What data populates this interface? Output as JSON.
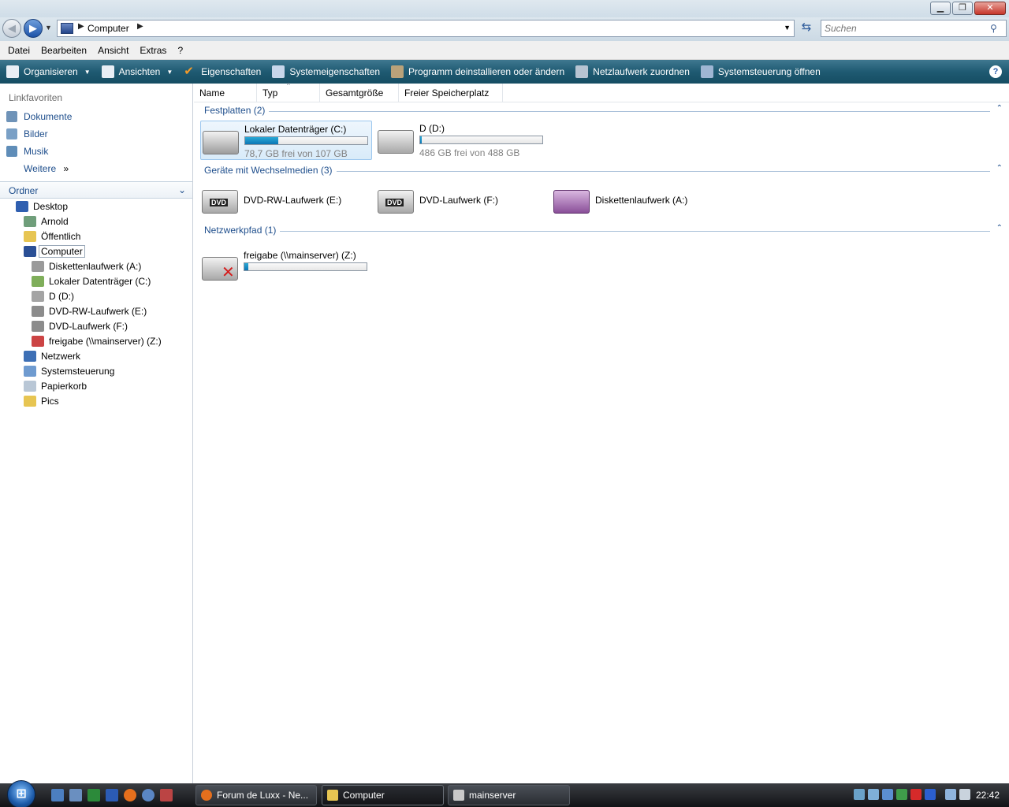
{
  "window": {
    "minimize": "▁",
    "maximize": "❐",
    "close": "✕"
  },
  "address": {
    "path": "Computer",
    "search_placeholder": "Suchen"
  },
  "menu": [
    "Datei",
    "Bearbeiten",
    "Ansicht",
    "Extras",
    "?"
  ],
  "commands": [
    {
      "label": "Organisieren",
      "icon": "organize-icon",
      "color": "#e8eef5",
      "dropdown": true
    },
    {
      "label": "Ansichten",
      "icon": "views-icon",
      "color": "#e8eef5",
      "dropdown": true
    },
    {
      "label": "Eigenschaften",
      "icon": "checkmark-icon",
      "color": "#f19a2b",
      "dropdown": false
    },
    {
      "label": "Systemeigenschaften",
      "icon": "system-properties-icon",
      "color": "#c8d6ea",
      "dropdown": false
    },
    {
      "label": "Programm deinstallieren oder ändern",
      "icon": "uninstall-icon",
      "color": "#b9a27a",
      "dropdown": false
    },
    {
      "label": "Netzlaufwerk zuordnen",
      "icon": "map-network-drive-icon",
      "color": "#b7c4d2",
      "dropdown": false
    },
    {
      "label": "Systemsteuerung öffnen",
      "icon": "control-panel-icon",
      "color": "#9fb6d3",
      "dropdown": false
    }
  ],
  "nav": {
    "favorites_heading": "Linkfavoriten",
    "favorites": [
      {
        "label": "Dokumente",
        "icon": "documents-icon",
        "color": "#6f93b8"
      },
      {
        "label": "Bilder",
        "icon": "pictures-icon",
        "color": "#7aa0c6"
      },
      {
        "label": "Musik",
        "icon": "music-icon",
        "color": "#5f8db8"
      }
    ],
    "more": "Weitere",
    "more_arrow": "»",
    "folders_label": "Ordner",
    "folders_chevron": "⌄",
    "tree": [
      {
        "label": "Desktop",
        "icon": "desktop-icon",
        "color": "#2f5fb0"
      },
      {
        "label": "Arnold",
        "icon": "user-folder-icon",
        "color": "#6f9e7a"
      },
      {
        "label": "Öffentlich",
        "icon": "folder-icon",
        "color": "#e7c552"
      },
      {
        "label": "Computer",
        "icon": "computer-icon",
        "color": "#2a4f95"
      },
      {
        "label": "Diskettenlaufwerk (A:)",
        "icon": "floppy-drive-icon",
        "color": "#9a9a9a"
      },
      {
        "label": "Lokaler Datenträger (C:)",
        "icon": "windows-drive-icon",
        "color": "#7fae5a"
      },
      {
        "label": "D (D:)",
        "icon": "hard-drive-icon",
        "color": "#a4a4a4"
      },
      {
        "label": "DVD-RW-Laufwerk (E:)",
        "icon": "dvd-drive-icon",
        "color": "#8c8c8c"
      },
      {
        "label": "DVD-Laufwerk (F:)",
        "icon": "dvd-drive-icon",
        "color": "#8c8c8c"
      },
      {
        "label": "freigabe (\\\\mainserver) (Z:)",
        "icon": "disconnected-network-drive-icon",
        "color": "#c44"
      },
      {
        "label": "Netzwerk",
        "icon": "network-icon",
        "color": "#3d6fb5"
      },
      {
        "label": "Systemsteuerung",
        "icon": "control-panel-icon",
        "color": "#6f9bd0"
      },
      {
        "label": "Papierkorb",
        "icon": "recycle-bin-icon",
        "color": "#b9c7d6"
      },
      {
        "label": "Pics",
        "icon": "folder-icon",
        "color": "#e7c552"
      }
    ]
  },
  "columns": [
    "Name",
    "Typ",
    "Gesamtgröße",
    "Freier Speicherplatz"
  ],
  "groups": [
    {
      "title": "Festplatten (2)",
      "toggle": "⌃"
    },
    {
      "title": "Geräte mit Wechselmedien (3)",
      "toggle": "⌃"
    },
    {
      "title": "Netzwerkpfad (1)",
      "toggle": "⌃"
    }
  ],
  "drives": {
    "c": {
      "name": "Lokaler Datenträger (C:)",
      "free": "78,7 GB frei von 107 GB",
      "used_fraction": 0.27
    },
    "d": {
      "name": "D (D:)",
      "free": "486 GB frei von 488 GB",
      "used_fraction": 0.01
    },
    "e": {
      "name": "DVD-RW-Laufwerk (E:)"
    },
    "f": {
      "name": "DVD-Laufwerk (F:)"
    },
    "a": {
      "name": "Diskettenlaufwerk (A:)"
    },
    "z": {
      "name": "freigabe (\\\\mainserver) (Z:)",
      "used_fraction": 0.03
    }
  },
  "taskbar": {
    "start": "⊞",
    "quicklaunch": [
      {
        "icon": "show-desktop-icon",
        "color": "#4c7fc0"
      },
      {
        "icon": "switch-windows-icon",
        "color": "#6a8fc0"
      },
      {
        "icon": "excel-icon",
        "color": "#2c8a3a"
      },
      {
        "icon": "word-icon",
        "color": "#2b5bb5"
      },
      {
        "icon": "firefox-icon",
        "color": "#e56f1d"
      },
      {
        "icon": "thunderbird-icon",
        "color": "#5a86c4"
      },
      {
        "icon": "tool-icon",
        "color": "#b44"
      }
    ],
    "buttons": [
      {
        "label": "Forum de Luxx - Ne...",
        "icon": "firefox-icon",
        "color": "#e56f1d"
      },
      {
        "label": "Computer",
        "icon": "folder-icon",
        "color": "#e7c552"
      },
      {
        "label": "mainserver",
        "icon": "remote-desktop-icon",
        "color": "#c9c9c9"
      }
    ],
    "tray": [
      {
        "icon": "tray-app-icon",
        "color": "#6aa2c9"
      },
      {
        "icon": "tray-app-icon",
        "color": "#7fb0d8"
      },
      {
        "icon": "tray-tool-icon",
        "color": "#5b8ed0"
      },
      {
        "icon": "tray-app-icon",
        "color": "#3f9c4a"
      },
      {
        "icon": "antivirus-icon",
        "color": "#d62a2a"
      },
      {
        "icon": "media-icon",
        "color": "#2b5fd0"
      },
      {
        "icon": "network-tray-icon",
        "color": "#8fb4dd"
      },
      {
        "icon": "volume-icon",
        "color": "#c9d3dd"
      }
    ],
    "clock": "22:42"
  }
}
